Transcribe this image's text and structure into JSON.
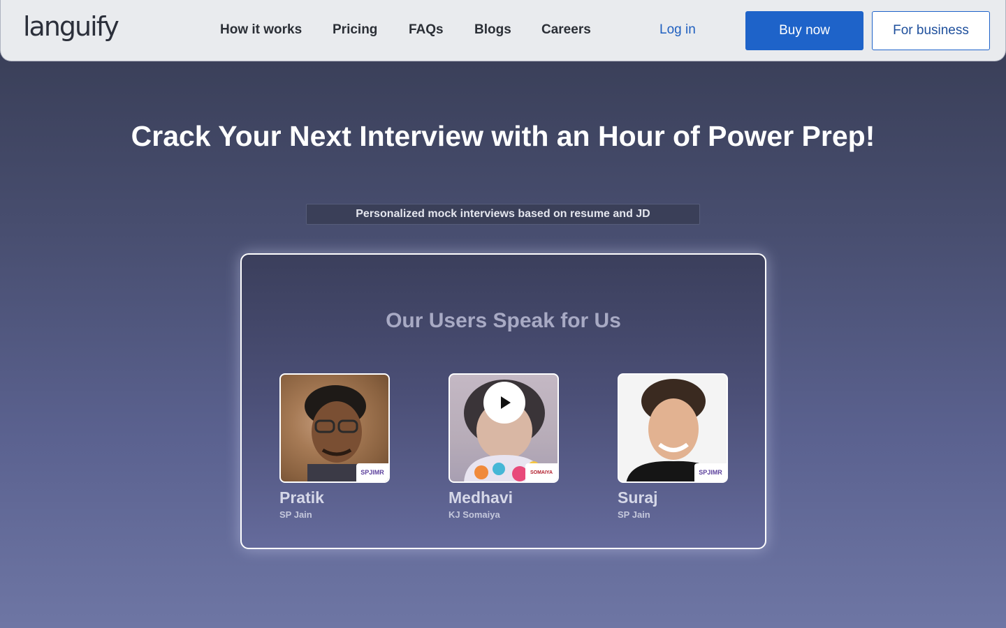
{
  "nav": {
    "logo": "languify",
    "links": [
      "How it works",
      "Pricing",
      "FAQs",
      "Blogs",
      "Careers"
    ],
    "login": "Log in",
    "buy_now": "Buy now",
    "for_business": "For business"
  },
  "hero": {
    "title": "Crack Your Next Interview with an Hour of Power Prep!",
    "subtitle": "Personalized mock interviews based on resume and JD"
  },
  "testimonials": {
    "title": "Our Users Speak for Us",
    "users": [
      {
        "name": "Pratik",
        "school": "SP Jain",
        "badge": "SPJIMR"
      },
      {
        "name": "Medhavi",
        "school": "KJ Somaiya",
        "badge": "SOMAIYA"
      },
      {
        "name": "Suraj",
        "school": "SP Jain",
        "badge": "SPJIMR"
      }
    ]
  },
  "colors": {
    "primary_blue": "#1e63c9",
    "nav_bg": "#e9ebee",
    "page_bg_top": "#363b52",
    "page_bg_bottom": "#6e76a4"
  }
}
